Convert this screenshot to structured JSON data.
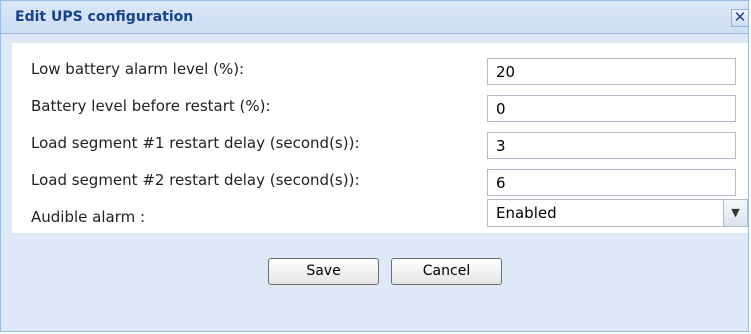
{
  "dialog": {
    "title": "Edit UPS configuration",
    "close_glyph": "✕"
  },
  "form": {
    "fields": [
      {
        "label": "Low battery alarm level (%):",
        "value": "20"
      },
      {
        "label": "Battery level before restart (%):",
        "value": "0"
      },
      {
        "label": "Load segment #1 restart delay (second(s)):",
        "value": "3"
      },
      {
        "label": "Load segment #2 restart delay (second(s)):",
        "value": "6"
      }
    ],
    "audible_alarm": {
      "label": "Audible alarm :",
      "selected": "Enabled",
      "trigger_glyph": "▼"
    }
  },
  "buttons": {
    "save": "Save",
    "cancel": "Cancel"
  }
}
